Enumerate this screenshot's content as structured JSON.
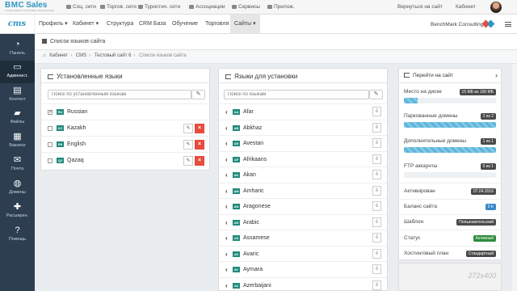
{
  "logo": {
    "brand": "BMC",
    "brand2": "Sales",
    "tagline": "СОЦИАЛЬНО-ТОРГОВАЯ ПЛАТФОРМА"
  },
  "topbar": {
    "links": [
      "Соц. сети",
      "Торгов. сети",
      "Туристич. сети",
      "Ассоциации",
      "Сервисы",
      "Прилож."
    ],
    "back": "Вернуться на сайт",
    "cabinet": "Кабинет"
  },
  "nav": {
    "logo": "cms",
    "items": [
      "Профиль ▾",
      "Кабинет ▾",
      "Структура",
      "CRM База",
      "Обучение",
      "Торговля",
      "Сайты ▾"
    ],
    "company": "BenchMark Consulting ▾"
  },
  "sidebar": [
    {
      "label": "Панель",
      "icon": "dashboard-icon"
    },
    {
      "label": "Админист.",
      "icon": "monitor-icon"
    },
    {
      "label": "Контент",
      "icon": "document-icon"
    },
    {
      "label": "Файлы",
      "icon": "folder-icon"
    },
    {
      "label": "Базапск",
      "icon": "storage-icon"
    },
    {
      "label": "Почта",
      "icon": "mail-icon"
    },
    {
      "label": "Домены",
      "icon": "globe-icon"
    },
    {
      "label": "Расширен.",
      "icon": "puzzle-icon"
    },
    {
      "label": "Помощь",
      "icon": "help-icon"
    }
  ],
  "page": {
    "title": "Список языков сайта"
  },
  "breadcrumb": [
    "Кабинет",
    "CMS",
    "Тестовый сайт 6",
    "Список языков сайта"
  ],
  "installed": {
    "title": "Установленные языки",
    "search_placeholder": "Поиск по установленным языкам",
    "rows": [
      {
        "code": "RU",
        "name": "Russian",
        "checked": true
      },
      {
        "code": "KZ",
        "name": "Kazakh",
        "checked": false
      },
      {
        "code": "EN",
        "name": "English",
        "checked": false
      },
      {
        "code": "QZ",
        "name": "Qazaq",
        "checked": false
      }
    ]
  },
  "available": {
    "title": "Языки для установки",
    "search_placeholder": "Поиск по языкам",
    "rows": [
      {
        "code": "AA",
        "name": "Afar"
      },
      {
        "code": "AB",
        "name": "Abkhaz"
      },
      {
        "code": "AE",
        "name": "Avestan"
      },
      {
        "code": "AF",
        "name": "Afrikaans"
      },
      {
        "code": "AK",
        "name": "Akan"
      },
      {
        "code": "AM",
        "name": "Amharic"
      },
      {
        "code": "AN",
        "name": "Aragonese"
      },
      {
        "code": "AR",
        "name": "Arabic"
      },
      {
        "code": "AS",
        "name": "Assamese"
      },
      {
        "code": "AV",
        "name": "Avaric"
      },
      {
        "code": "AY",
        "name": "Aymara"
      },
      {
        "code": "AZ",
        "name": "Azerbaijani"
      }
    ]
  },
  "info": {
    "goto": "Перейти на сайт",
    "disk_label": "Место на диске",
    "disk_value": "15 МБ из 100 МБ",
    "disk_fraction": 0.15,
    "parked_label": "Паркованные домены",
    "parked_value": "2 из 2",
    "parked_fraction": 1.0,
    "extra_label": "Дополнительные домены",
    "extra_value": "1 из 1",
    "extra_fraction": 1.0,
    "ftp_label": "FTP аккаунты",
    "ftp_value": "0 из 1",
    "ftp_fraction": 0.0,
    "activated_label": "Активирован",
    "activated_value": "07.04.2016",
    "balance_label": "Баланс сайта",
    "balance_value": "0 tr",
    "template_label": "Шаблон",
    "template_value": "Пользовательский",
    "status_label": "Статус",
    "status_value": "Активный",
    "plan_label": "Хостинговый план",
    "plan_value": "Стандартный",
    "placeholder": "272x400"
  },
  "colors": {
    "accent": "#2f96c4",
    "sidebar": "#2c3e50",
    "lang_code": "#1f8a7a",
    "delete": "#e74c3c",
    "progress": "#5bb4dc"
  }
}
